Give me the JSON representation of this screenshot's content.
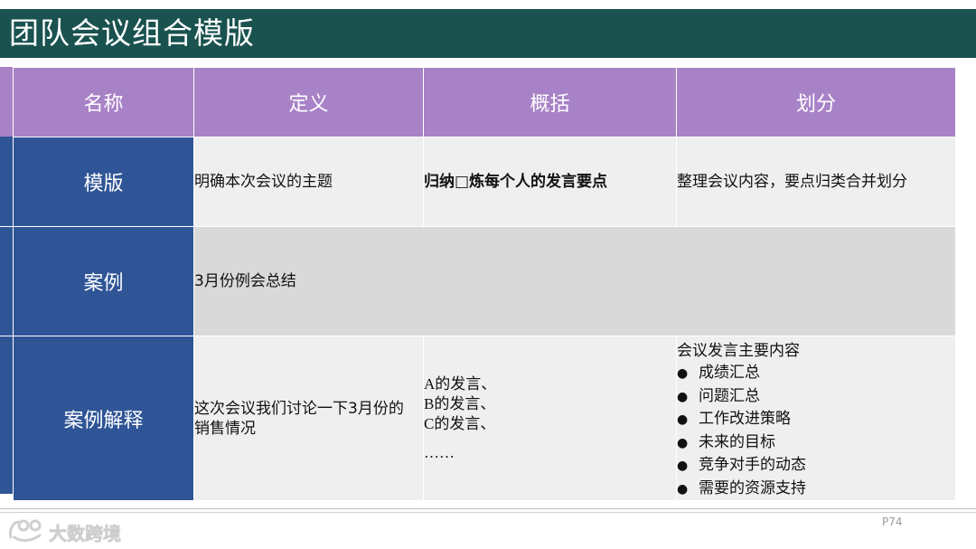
{
  "title": "团队会议组合模版",
  "table": {
    "headers": [
      "名称",
      "定义",
      "概括",
      "划分"
    ],
    "rows": [
      {
        "name": "模版",
        "definition": "明确本次会议的主题",
        "summary_before": "归纳",
        "summary_blank": "□",
        "summary_after": "炼每个人的发言要点",
        "division": "整理会议内容，要点归类合并划分"
      },
      {
        "name": "案例",
        "content": "3月份例会总结"
      },
      {
        "name": "案例解释",
        "definition": "这次会议我们讨论一下3月份的销售情况",
        "summary_lines": [
          "A的发言、",
          "B的发言、",
          "C的发言、",
          "……"
        ],
        "division_title": "会议发言主要内容",
        "division_items": [
          "成绩汇总",
          "问题汇总",
          "工作改进策略",
          "未来的目标",
          "竞争对手的动态",
          "需要的资源支持"
        ]
      }
    ]
  },
  "footer": {
    "page": "P74",
    "logo_text": "大数跨境"
  }
}
